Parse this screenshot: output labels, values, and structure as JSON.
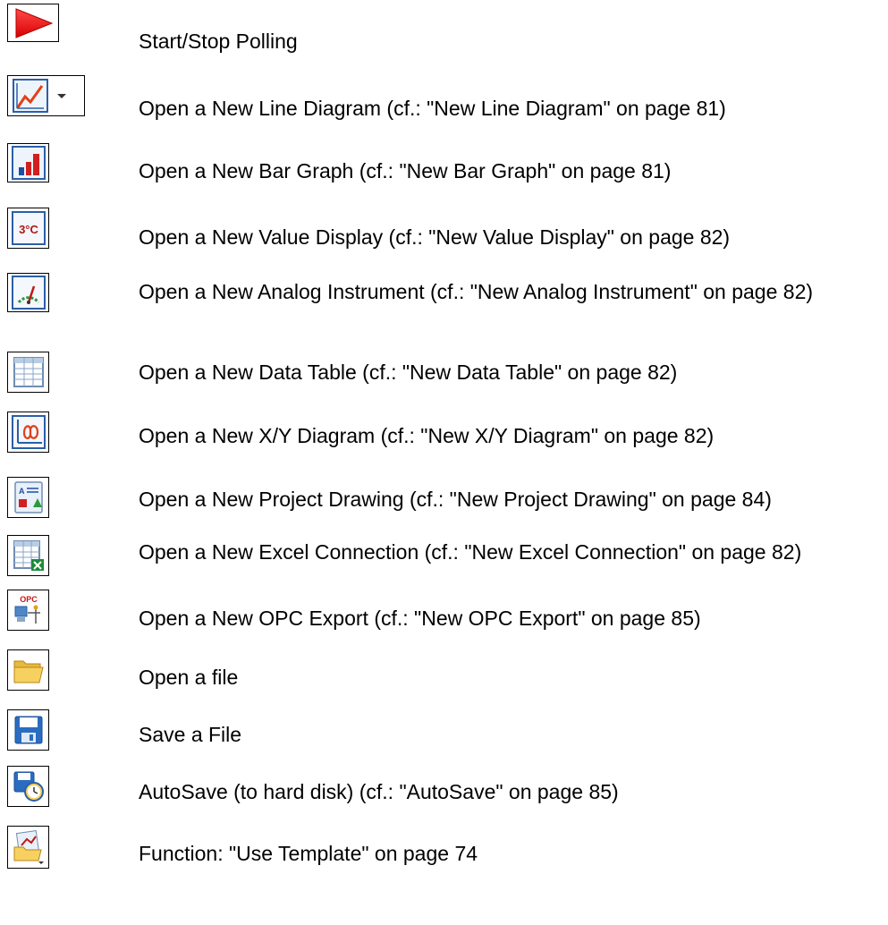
{
  "items": [
    {
      "icon": "play-icon",
      "label": "Start/Stop Polling"
    },
    {
      "icon": "line-diagram-icon",
      "label": "Open a New Line Diagram (cf.: \"New Line Diagram\" on page 81)"
    },
    {
      "icon": "bar-graph-icon",
      "label": "Open a New Bar Graph (cf.: \"New Bar Graph\" on page 81)"
    },
    {
      "icon": "value-display-icon",
      "icon_text": "3°C",
      "label": "Open a New Value Display (cf.: \"New Value Display\" on page 82)"
    },
    {
      "icon": "analog-instrument-icon",
      "label": "Open a New Analog Instrument (cf.: \"New Analog Instrument\" on page 82)"
    },
    {
      "icon": "data-table-icon",
      "label": "Open a New Data Table (cf.: \"New Data Table\" on page 82)"
    },
    {
      "icon": "xy-diagram-icon",
      "label": "Open a New X/Y Diagram (cf.: \"New X/Y Diagram\" on page 82)"
    },
    {
      "icon": "project-drawing-icon",
      "label": "Open a New Project Drawing (cf.: \"New Project Drawing\" on page 84)"
    },
    {
      "icon": "excel-connection-icon",
      "label": "Open a New Excel Connection (cf.: \"New Excel Connection\" on page 82)"
    },
    {
      "icon": "opc-export-icon",
      "icon_text": "OPC",
      "label": "Open a New OPC Export (cf.: \"New OPC Export\" on page 85)"
    },
    {
      "icon": "folder-open-icon",
      "label": "Open a file"
    },
    {
      "icon": "save-disk-icon",
      "label": "Save a File"
    },
    {
      "icon": "autosave-icon",
      "label": "AutoSave (to hard disk) (cf.: \"AutoSave\" on page 85)"
    },
    {
      "icon": "use-template-icon",
      "label": "Function: \"Use Template\" on page 74"
    }
  ]
}
